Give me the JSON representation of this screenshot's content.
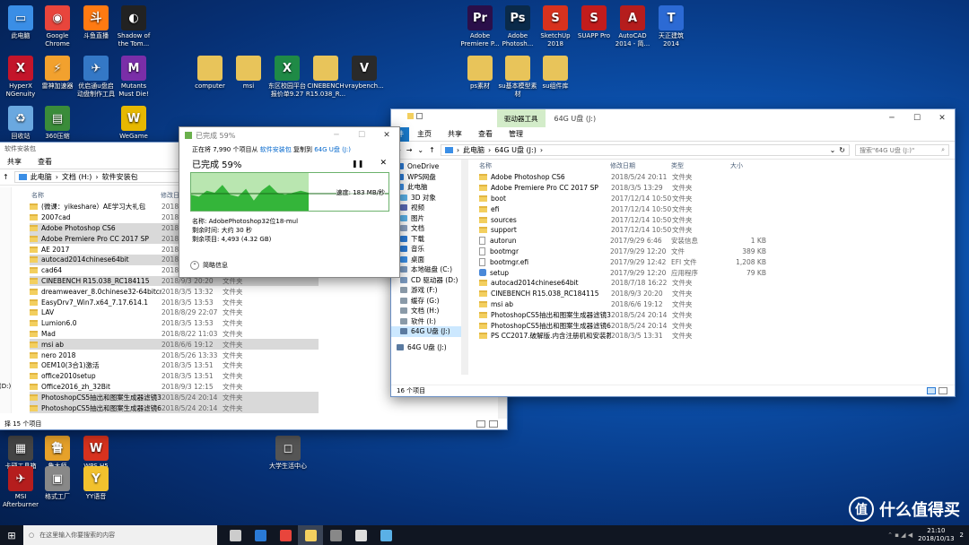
{
  "desktop_icons": [
    {
      "label": "此电脑",
      "color": "#3a8ee6",
      "glyph": "▭"
    },
    {
      "label": "Google Chrome",
      "color": "#e8453c",
      "glyph": "◉"
    },
    {
      "label": "斗鱼直播",
      "color": "#ff7a12",
      "glyph": "斗"
    },
    {
      "label": "Shadow of the Tom...",
      "color": "#222",
      "glyph": "◐"
    },
    {
      "label": "HyperX NGenuity",
      "color": "#c3152a",
      "glyph": "X"
    },
    {
      "label": "雷神加速器",
      "color": "#f2a12e",
      "glyph": "⚡"
    },
    {
      "label": "优启通u盘启动盘制作工具",
      "color": "#3478c6",
      "glyph": "✈"
    },
    {
      "label": "Mutants Must Die!",
      "color": "#7a2ea8",
      "glyph": "M"
    },
    {
      "label": "回收站",
      "color": "#6aa8e0",
      "glyph": "♻"
    },
    {
      "label": "360压缩",
      "color": "#3a8c3a",
      "glyph": "▤"
    },
    {
      "label": "WeGame",
      "color": "#e6b800",
      "glyph": "W"
    },
    {
      "label": "computer",
      "color": "#e8c45a",
      "glyph": ""
    },
    {
      "label": "msi",
      "color": "#e8c45a",
      "glyph": ""
    },
    {
      "label": "东区校园平台报价单9.27",
      "color": "#1f8a46",
      "glyph": "X"
    },
    {
      "label": "CINEBENCH R15.038_R...",
      "color": "#e8c45a",
      "glyph": ""
    },
    {
      "label": "vraybench...",
      "color": "#2a2a2a",
      "glyph": "V"
    },
    {
      "label": "Adobe Premiere P...",
      "color": "#2a0f4a",
      "glyph": "Pr"
    },
    {
      "label": "Adobe Photosh...",
      "color": "#0a2a4a",
      "glyph": "Ps"
    },
    {
      "label": "SketchUp 2018",
      "color": "#d8321e",
      "glyph": "S"
    },
    {
      "label": "SUAPP Pro",
      "color": "#c21c1c",
      "glyph": "S"
    },
    {
      "label": "AutoCAD 2014 - 简...",
      "color": "#b51d1d",
      "glyph": "A"
    },
    {
      "label": "天正建筑 2014",
      "color": "#2c6ad4",
      "glyph": "T"
    },
    {
      "label": "ps素材",
      "color": "#e8c45a",
      "glyph": ""
    },
    {
      "label": "su基本模型素材",
      "color": "#e8c45a",
      "glyph": ""
    },
    {
      "label": "su组件库",
      "color": "#e8c45a",
      "glyph": ""
    },
    {
      "label": "卡硬工具箱",
      "color": "#444",
      "glyph": "▦"
    },
    {
      "label": "鲁大师",
      "color": "#e6a12a",
      "glyph": "鲁"
    },
    {
      "label": "WPS H5",
      "color": "#d8321e",
      "glyph": "W"
    },
    {
      "label": "大学生活中心",
      "color": "#555",
      "glyph": "◻"
    },
    {
      "label": "MSI Afterburner",
      "color": "#b51d1d",
      "glyph": "✈"
    },
    {
      "label": "格式工厂",
      "color": "#888",
      "glyph": "▣"
    },
    {
      "label": "YY语音",
      "color": "#f2c12e",
      "glyph": "Y"
    }
  ],
  "left_explorer": {
    "title": "软件安装包",
    "tabs": [
      "共享",
      "查看"
    ],
    "breadcrumb": [
      "此电脑",
      "文档 (H:)",
      "软件安装包"
    ],
    "col_name": "名称",
    "col_date": "修改日",
    "side_labels": [
      "(D:)"
    ],
    "status": "择 15 个项目",
    "rows": [
      {
        "name": "(微课：yikeshare）AE学习大礼包",
        "date": "2018",
        "type": "",
        "sel": false
      },
      {
        "name": "2007cad",
        "date": "2018",
        "type": "",
        "sel": false
      },
      {
        "name": "Adobe Photoshop CS6",
        "date": "2018",
        "type": "",
        "sel": true
      },
      {
        "name": "Adobe Premiere Pro CC 2017 SP",
        "date": "2018",
        "type": "",
        "sel": true
      },
      {
        "name": "AE 2017",
        "date": "2018",
        "type": "",
        "sel": false
      },
      {
        "name": "autocad2014chinese64bit",
        "date": "2018",
        "type": "",
        "sel": true
      },
      {
        "name": "cad64",
        "date": "2018",
        "type": "",
        "sel": false
      },
      {
        "name": "CINEBENCH R15.038_RC184115",
        "date": "2018/9/3 20:20",
        "type": "文件夹",
        "sel": true
      },
      {
        "name": "dreamweaver_8.0chinese32-64bitcrac...",
        "date": "2018/3/5 13:32",
        "type": "文件夹",
        "sel": false
      },
      {
        "name": "EasyDrv7_Win7.x64_7.17.614.1",
        "date": "2018/3/5 13:53",
        "type": "文件夹",
        "sel": false
      },
      {
        "name": "LAV",
        "date": "2018/8/29 22:07",
        "type": "文件夹",
        "sel": false
      },
      {
        "name": "Lumion6.0",
        "date": "2018/3/5 13:53",
        "type": "文件夹",
        "sel": false
      },
      {
        "name": "Mad",
        "date": "2018/8/22 11:03",
        "type": "文件夹",
        "sel": false
      },
      {
        "name": "msi  ab",
        "date": "2018/6/6 19:12",
        "type": "文件夹",
        "sel": true
      },
      {
        "name": "nero 2018",
        "date": "2018/5/26 13:33",
        "type": "文件夹",
        "sel": false
      },
      {
        "name": "OEM10(3合1)激活",
        "date": "2018/3/5 13:51",
        "type": "文件夹",
        "sel": false
      },
      {
        "name": "office2010setup",
        "date": "2018/3/5 13:51",
        "type": "文件夹",
        "sel": false
      },
      {
        "name": "Office2016_zh_32Bit",
        "date": "2018/9/3 12:15",
        "type": "文件夹",
        "sel": false
      },
      {
        "name": "PhotoshopCS5抽出和图案生成器滤镜3...",
        "date": "2018/5/24 20:14",
        "type": "文件夹",
        "sel": true
      },
      {
        "name": "PhotoshopCS5抽出和图案生成器滤镜6...",
        "date": "2018/5/24 20:14",
        "type": "文件夹",
        "sel": true
      }
    ]
  },
  "copy_dialog": {
    "title": "已完成 59%",
    "line1_prefix": "正在将 7,990 个项目从",
    "line1_from": "软件安装包",
    "line1_mid": "复制到",
    "line1_to": "64G U盘 (J:)",
    "progress_label": "已完成 59%",
    "progress_pct": 59,
    "speed": "速度: 183 MB/秒",
    "name_label": "名称: AdobePhotoshop32位18-mul",
    "time_label": "剩余时间: 大约 30 秒",
    "items_label": "剩余项目: 4,493 (4.32 GB)",
    "details": "简略信息",
    "pause_icon": "pause",
    "cancel_icon": "close"
  },
  "right_explorer": {
    "title": "64G U盘 (J:)",
    "context_tab": "驱动器工具",
    "tabs": [
      "件",
      "主页",
      "共享",
      "查看",
      "管理"
    ],
    "breadcrumb": [
      "此电脑",
      "64G U盘 (J:)"
    ],
    "search_placeholder": "搜索\"64G U盘 (J:)\"",
    "cols": [
      "名称",
      "修改日期",
      "类型",
      "大小"
    ],
    "nav": [
      {
        "label": "OneDrive",
        "color": "#2a7ad6"
      },
      {
        "label": "WPS网盘",
        "color": "#2a7ad6"
      },
      {
        "label": "此电脑",
        "color": "#3a8ee6"
      },
      {
        "label": "3D 对象",
        "color": "#5ab0e6"
      },
      {
        "label": "视频",
        "color": "#5a6ab6"
      },
      {
        "label": "图片",
        "color": "#5ab0e6"
      },
      {
        "label": "文档",
        "color": "#8aa0c0"
      },
      {
        "label": "下载",
        "color": "#2a7ad6"
      },
      {
        "label": "音乐",
        "color": "#2a7ad6"
      },
      {
        "label": "桌面",
        "color": "#3a8ee6"
      },
      {
        "label": "本地磁盘 (C:)",
        "color": "#7a9ac0"
      },
      {
        "label": "CD 驱动器 (D:)",
        "color": "#7a9ac0"
      },
      {
        "label": "游戏 (F:)",
        "color": "#8a9aa8"
      },
      {
        "label": "缓存 (G:)",
        "color": "#8a9aa8"
      },
      {
        "label": "文档 (H:)",
        "color": "#8a9aa8"
      },
      {
        "label": "软件 (I:)",
        "color": "#8a9aa8"
      },
      {
        "label": "64G U盘 (J:)",
        "color": "#5a7aa0"
      },
      {
        "label": "64G U盘 (J:)",
        "color": "#5a7aa0"
      }
    ],
    "rows": [
      {
        "name": "Adobe Photoshop CS6",
        "date": "2018/5/24 20:11",
        "type": "文件夹",
        "size": "",
        "kind": "folder"
      },
      {
        "name": "Adobe Premiere Pro CC 2017 SP",
        "date": "2018/3/5 13:29",
        "type": "文件夹",
        "size": "",
        "kind": "folder"
      },
      {
        "name": "boot",
        "date": "2017/12/14 10:50",
        "type": "文件夹",
        "size": "",
        "kind": "folder"
      },
      {
        "name": "efi",
        "date": "2017/12/14 10:50",
        "type": "文件夹",
        "size": "",
        "kind": "folder"
      },
      {
        "name": "sources",
        "date": "2017/12/14 10:50",
        "type": "文件夹",
        "size": "",
        "kind": "folder"
      },
      {
        "name": "support",
        "date": "2017/12/14 10:50",
        "type": "文件夹",
        "size": "",
        "kind": "folder"
      },
      {
        "name": "autorun",
        "date": "2017/9/29 6:46",
        "type": "安装信息",
        "size": "1 KB",
        "kind": "file"
      },
      {
        "name": "bootmgr",
        "date": "2017/9/29 12:20",
        "type": "文件",
        "size": "389 KB",
        "kind": "file"
      },
      {
        "name": "bootmgr.efi",
        "date": "2017/9/29 12:42",
        "type": "EFI 文件",
        "size": "1,208 KB",
        "kind": "file"
      },
      {
        "name": "setup",
        "date": "2017/9/29 12:20",
        "type": "应用程序",
        "size": "79 KB",
        "kind": "app"
      },
      {
        "name": "autocad2014chinese64bit",
        "date": "2018/7/18 16:22",
        "type": "文件夹",
        "size": "",
        "kind": "folder"
      },
      {
        "name": "CINEBENCH R15.038_RC184115",
        "date": "2018/9/3 20:20",
        "type": "文件夹",
        "size": "",
        "kind": "folder"
      },
      {
        "name": "msi  ab",
        "date": "2018/6/6 19:12",
        "type": "文件夹",
        "size": "",
        "kind": "folder"
      },
      {
        "name": "PhotoshopCS5抽出和图案生成器滤镜3...",
        "date": "2018/5/24 20:14",
        "type": "文件夹",
        "size": "",
        "kind": "folder"
      },
      {
        "name": "PhotoshopCS5抽出和图案生成器滤镜6...",
        "date": "2018/5/24 20:14",
        "type": "文件夹",
        "size": "",
        "kind": "folder"
      },
      {
        "name": "PS CC2017.破解版.内含注册机和安装教程",
        "date": "2018/3/5 13:31",
        "type": "文件夹",
        "size": "",
        "kind": "folder"
      }
    ],
    "status": "16 个项目"
  },
  "taskbar": {
    "search_placeholder": "在这里输入你要搜索的内容",
    "time": "21:10",
    "date": "2018/10/13",
    "badge": "2",
    "watermark": "什么值得买",
    "icons": [
      {
        "name": "task-view-icon",
        "color": "#ccc"
      },
      {
        "name": "edge-icon",
        "color": "#2a7ad6"
      },
      {
        "name": "chrome-taskbar-icon",
        "color": "#e8453c"
      },
      {
        "name": "file-explorer-taskbar-icon",
        "color": "#f3cf5f"
      },
      {
        "name": "store-icon",
        "color": "#888"
      },
      {
        "name": "mail-icon",
        "color": "#ddd"
      },
      {
        "name": "network-app-icon",
        "color": "#5ab0e6"
      }
    ]
  }
}
